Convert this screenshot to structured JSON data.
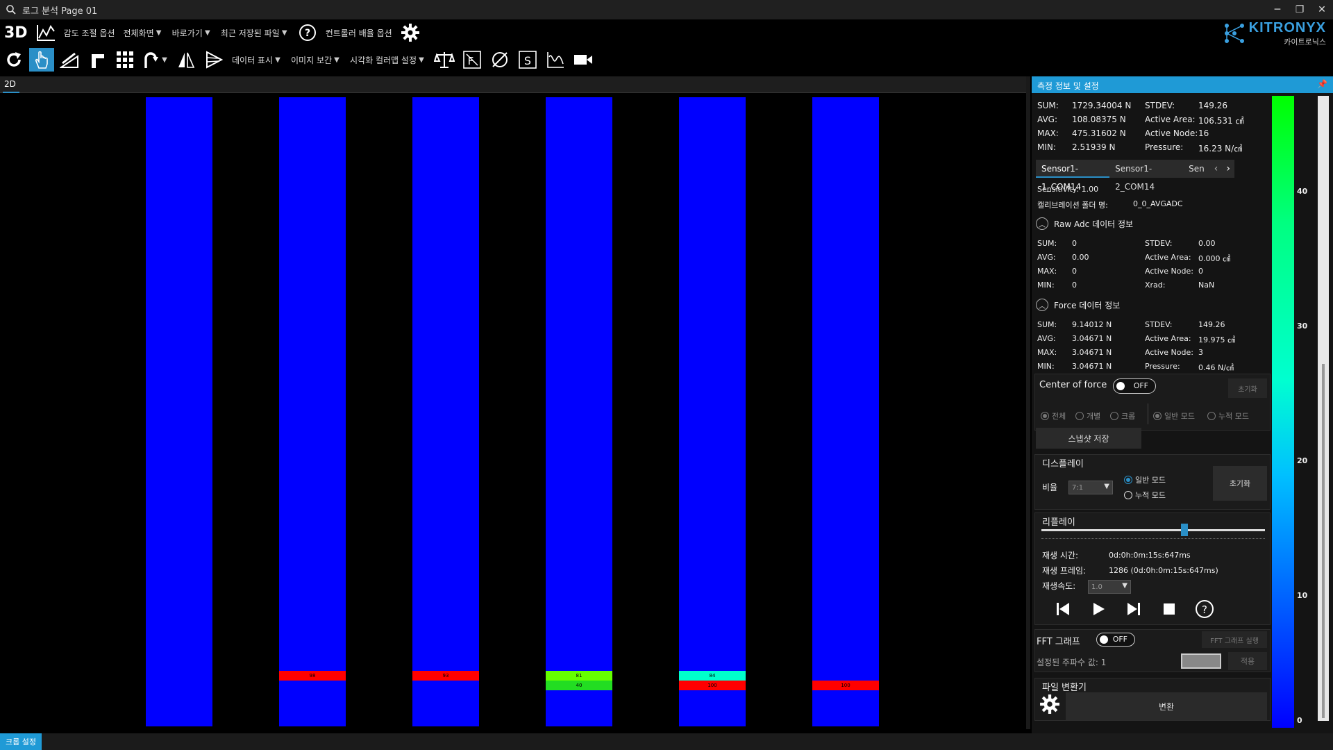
{
  "title": "로그 분석 Page 01",
  "toolbar1": {
    "btn_3d": "3D",
    "sensitivity": "감도 조절 옵션",
    "fullscreen": "전체화면",
    "shortcut": "바로가기",
    "recent": "최근 저장된 파일",
    "controller": "컨트롤러 배율 옵션"
  },
  "toolbar2": {
    "data_display": "데이터 표시",
    "interp": "이미지 보간",
    "colormap": "시각화 컬러맵 설정"
  },
  "logo": {
    "brand": "KITRONYX",
    "sub": "카이트로닉스"
  },
  "main": {
    "tab": "2D"
  },
  "columns": [
    {
      "segments": [
        {
          "value": "98",
          "color": "#ff0000"
        }
      ]
    },
    {
      "segments": [
        {
          "value": "93",
          "color": "#ff0000"
        }
      ]
    },
    {
      "segments": [
        {
          "value": "81",
          "color": "#66ff00"
        },
        {
          "value": "40",
          "color": "#22dd22"
        }
      ]
    },
    {
      "segments": [
        {
          "value": "84",
          "color": "#00ffcc"
        },
        {
          "value": "100",
          "color": "#ff0000"
        }
      ]
    },
    {
      "segments": [
        {
          "value": "100",
          "color": "#ff0000"
        }
      ]
    }
  ],
  "panel": {
    "header": "측정 정보 및 설정",
    "top_stats": {
      "sum_l": "SUM:",
      "sum": "1729.34004 N",
      "avg_l": "AVG:",
      "avg": "108.08375 N",
      "max_l": "MAX:",
      "max": "475.31602 N",
      "min_l": "MIN:",
      "min": "2.51939 N",
      "stdev_l": "STDEV:",
      "stdev": "149.26",
      "area_l": "Active Area:",
      "area": "106.531 ㎠",
      "node_l": "Active Node:",
      "node": "16",
      "press_l": "Pressure:",
      "press": "16.23 N/㎠"
    },
    "sensor_tabs": [
      "Sensor1-1_COM14",
      "Sensor1-2_COM14",
      "Sen"
    ],
    "sensitivity": "Sensitivity:  1.00",
    "calib": "캘리브레이션 폴더 명:",
    "calib_val": "0_0_AVGADC",
    "raw_hdr": "Raw Adc 데이터 정보",
    "raw": {
      "sum": "0",
      "avg": "0.00",
      "max": "0",
      "min": "0",
      "stdev": "0.00",
      "area": "0.000 ㎠",
      "node": "0",
      "xrad_l": "Xrad:",
      "xrad": "NaN"
    },
    "force_hdr": "Force 데이터 정보",
    "force": {
      "sum": "9.14012 N",
      "avg": "3.04671 N",
      "max": "3.04671 N",
      "min": "3.04671 N",
      "stdev": "149.26",
      "area": "19.975 ㎠",
      "node": "3",
      "press": "0.46 N/㎠"
    },
    "cof": "Center of force",
    "off": "OFF",
    "reset": "초기화",
    "radios": [
      "전체",
      "개별",
      "크롭",
      "일반 모드",
      "누적 모드"
    ],
    "snapshot": "스냅샷 저장",
    "display": {
      "title": "디스플레이",
      "ratio": "비율",
      "ratio_val": "7:1",
      "normal": "일반 모드",
      "accum": "누적 모드",
      "reset": "초기화"
    },
    "replay": {
      "title": "리플레이",
      "progress_pct": 64,
      "time_l": "재생 시간:",
      "time": "0d:0h:0m:15s:647ms",
      "frame_l": "재생 프레임:",
      "frame": "1286 (0d:0h:0m:15s:647ms)",
      "speed_l": "재생속도:",
      "speed": "1.0"
    },
    "fft": {
      "title": "FFT 그래프",
      "off": "OFF",
      "run": "FFT 그래프 실행",
      "freq": "설정된 주파수 값: 1",
      "apply": "적용"
    },
    "convert": {
      "title": "파일 변환기",
      "btn": "변환"
    }
  },
  "scale": {
    "labels": [
      "40",
      "30",
      "20",
      "10",
      "0"
    ]
  },
  "status": {
    "crop": "크롭 설정"
  }
}
